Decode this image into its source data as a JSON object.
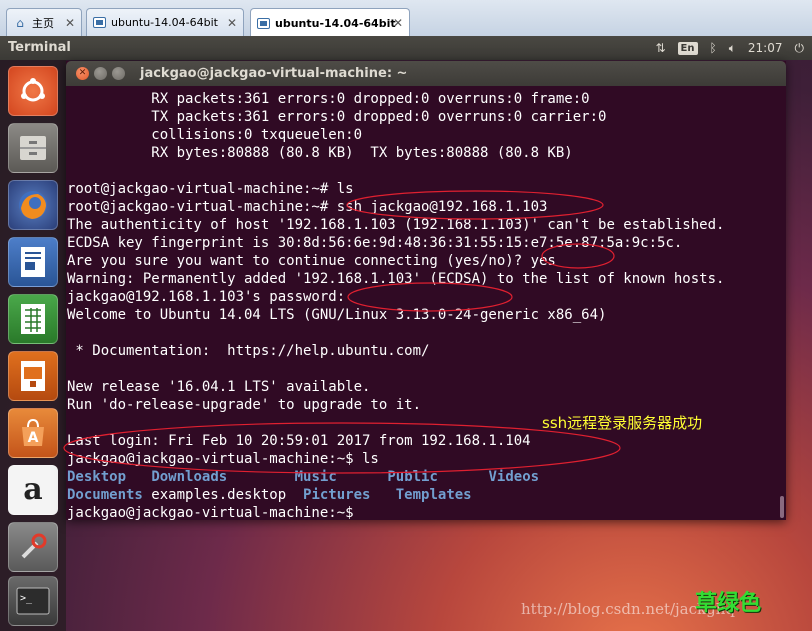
{
  "vm_tabs": [
    {
      "label": "主页",
      "icon": "home-icon"
    },
    {
      "label": "ubuntu-14.04-64bit",
      "icon": "vm-icon"
    },
    {
      "label": "ubuntu-14.04-64bit",
      "icon": "vm-icon",
      "active": true
    }
  ],
  "top_panel": {
    "app_title": "Terminal",
    "keyboard": "En",
    "clock": "21:07"
  },
  "launcher_items": [
    "ubuntu-dash-icon",
    "files-icon",
    "firefox-icon",
    "writer-icon",
    "calc-icon",
    "impress-icon",
    "software-center-icon",
    "amazon-icon",
    "system-settings-icon",
    "terminal-icon"
  ],
  "terminal": {
    "window_title": "jackgao@jackgao-virtual-machine: ~",
    "lines": [
      "          RX packets:361 errors:0 dropped:0 overruns:0 frame:0",
      "          TX packets:361 errors:0 dropped:0 overruns:0 carrier:0",
      "          collisions:0 txqueuelen:0",
      "          RX bytes:80888 (80.8 KB)  TX bytes:80888 (80.8 KB)",
      "",
      "root@jackgao-virtual-machine:~# ls",
      "root@jackgao-virtual-machine:~# ssh jackgao@192.168.1.103",
      "The authenticity of host '192.168.1.103 (192.168.1.103)' can't be established.",
      "ECDSA key fingerprint is 30:8d:56:6e:9d:48:36:31:55:15:e7:5e:87:5a:9c:5c.",
      "Are you sure you want to continue connecting (yes/no)? yes",
      "Warning: Permanently added '192.168.1.103' (ECDSA) to the list of known hosts.",
      "jackgao@192.168.1.103's password:",
      "Welcome to Ubuntu 14.04 LTS (GNU/Linux 3.13.0-24-generic x86_64)",
      "",
      " * Documentation:  https://help.ubuntu.com/",
      "",
      "New release '16.04.1 LTS' available.",
      "Run 'do-release-upgrade' to upgrade to it.",
      "",
      "Last login: Fri Feb 10 20:59:01 2017 from 192.168.1.104",
      "jackgao@jackgao-virtual-machine:~$ ls"
    ],
    "ls_output": [
      [
        "Desktop",
        "Downloads",
        "Music",
        "Public",
        "Videos"
      ],
      [
        "Documents",
        "examples.desktop",
        "Pictures",
        "Templates"
      ]
    ],
    "prompt": "jackgao@jackgao-virtual-machine:~$"
  },
  "annotations": {
    "note": "ssh远程登录服务器成功",
    "mark": "草绿色",
    "watermark": "http://blog.csdn.net/jackghq"
  }
}
